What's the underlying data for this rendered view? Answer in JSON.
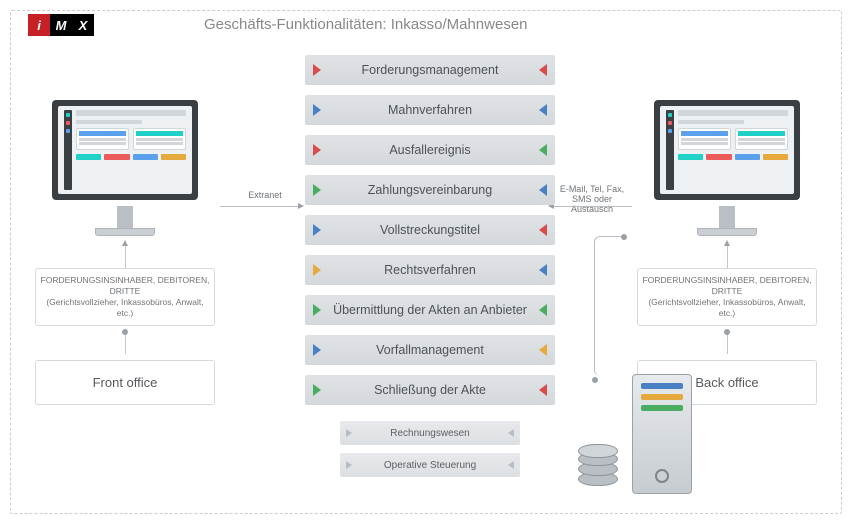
{
  "header": {
    "logo_i": "i",
    "logo_m": "M",
    "logo_x": "X",
    "title": "Geschäfts-Funktionalitäten: Inkasso/Mahnwesen"
  },
  "left": {
    "parties_line1": "FORDERUNGSINSINHABER, DEBITOREN, DRITTE",
    "parties_line2": "(Gerichtsvollzieher, Inkassobüros, Anwalt, etc.)",
    "office": "Front office",
    "conn_label": "Extranet"
  },
  "right": {
    "parties_line1": "FORDERUNGSINSINHABER, DEBITOREN, DRITTE",
    "parties_line2": "(Gerichtsvollzieher, Inkassobüros, Anwalt, etc.)",
    "office": "Back office",
    "conn_label": "E-Mail, Tel, Fax,\nSMS oder Austausch"
  },
  "processes": [
    {
      "label": "Forderungsmanagement",
      "left": "red",
      "right": "red"
    },
    {
      "label": "Mahnverfahren",
      "left": "blue",
      "right": "blue"
    },
    {
      "label": "Ausfallereignis",
      "left": "red",
      "right": "green"
    },
    {
      "label": "Zahlungsvereinbarung",
      "left": "green",
      "right": "blue"
    },
    {
      "label": "Vollstreckungstitel",
      "left": "blue",
      "right": "red"
    },
    {
      "label": "Rechtsverfahren",
      "left": "yellow",
      "right": "blue"
    },
    {
      "label": "Übermittlung der Akten an Anbieter",
      "left": "green",
      "right": "green"
    },
    {
      "label": "Vorfallmanagement",
      "left": "blue",
      "right": "yellow"
    },
    {
      "label": "Schließung der Akte",
      "left": "green",
      "right": "red"
    }
  ],
  "sub_processes": [
    "Rechnungswesen",
    "Operative Steuerung"
  ]
}
